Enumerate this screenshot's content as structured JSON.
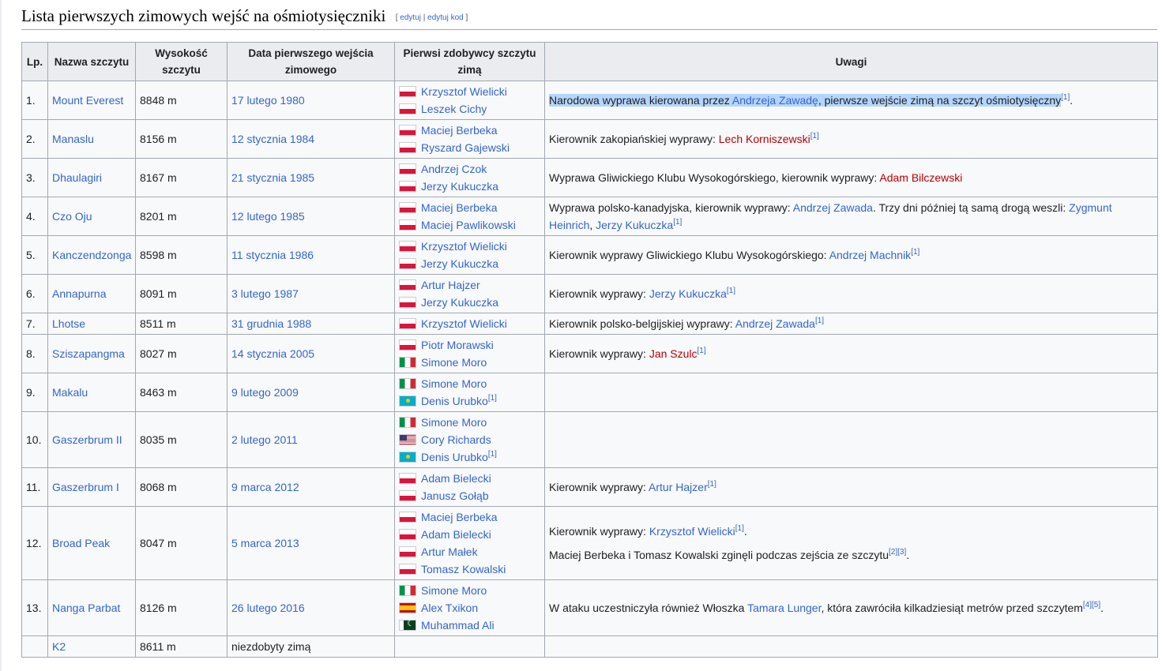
{
  "heading": {
    "title": "Lista pierwszych zimowych wejść na ośmiotysięczniki",
    "edit_open": "[ ",
    "edit_label": "edytuj",
    "edit_sep": " | ",
    "edit_code_label": "edytuj kod",
    "edit_close": " ]"
  },
  "table": {
    "headers": {
      "lp": "Lp.",
      "name": "Nazwa szczytu",
      "height": "Wysokość szczytu",
      "date": "Data pierwszego wejścia zimowego",
      "climbers": "Pierwsi zdobywcy szczytu zimą",
      "notes": "Uwagi"
    },
    "ref": {
      "r1": "[1]",
      "r2": "[2]",
      "r3": "[3]",
      "r4": "[4]",
      "r5": "[5]"
    },
    "rows": [
      {
        "lp": "1.",
        "name": "Mount Everest",
        "height": "8848 m",
        "date": "17 lutego 1980",
        "climbers": [
          "Krzysztof Wielicki",
          "Leszek Cichy"
        ],
        "note": {
          "t1": "Narodowa wyprawa kierowana przez ",
          "link": "Andrzeja Zawadę",
          "t2": ", pierwsze wejście zimą na szczyt ośmiotysięczny",
          "t3": "."
        }
      },
      {
        "lp": "2.",
        "name": "Manaslu",
        "height": "8156 m",
        "date": "12 stycznia 1984",
        "climbers": [
          "Maciej Berbeka",
          "Ryszard Gajewski"
        ],
        "note": {
          "t1": "Kierownik zakopiańskiej wyprawy: ",
          "link": "Lech Korniszewski"
        }
      },
      {
        "lp": "3.",
        "name": "Dhaulagiri",
        "height": "8167 m",
        "date": "21 stycznia 1985",
        "climbers": [
          "Andrzej Czok",
          "Jerzy Kukuczka"
        ],
        "note": {
          "t1": "Wyprawa Gliwickiego Klubu Wysokogórskiego, kierownik wyprawy: ",
          "link": "Adam Bilczewski"
        }
      },
      {
        "lp": "4.",
        "name": "Czo Oju",
        "height": "8201 m",
        "date": "12 lutego 1985",
        "climbers": [
          "Maciej Berbeka",
          "Maciej Pawlikowski"
        ],
        "note": {
          "t1": "Wyprawa polsko-kanadyjska, kierownik wyprawy: ",
          "link": "Andrzej Zawada",
          "t2": ". Trzy dni później tą samą drogą weszli: ",
          "link2": "Zygmunt Heinrich",
          "t3": ", ",
          "link3": "Jerzy Kukuczka"
        }
      },
      {
        "lp": "5.",
        "name": "Kanczendzonga",
        "height": "8598 m",
        "date": "11 stycznia 1986",
        "climbers": [
          "Krzysztof Wielicki",
          "Jerzy Kukuczka"
        ],
        "note": {
          "t1": "Kierownik wyprawy Gliwickiego Klubu Wysokogórskiego: ",
          "link": "Andrzej Machnik"
        }
      },
      {
        "lp": "6.",
        "name": "Annapurna",
        "height": "8091 m",
        "date": "3 lutego 1987",
        "climbers": [
          "Artur Hajzer",
          "Jerzy Kukuczka"
        ],
        "note": {
          "t1": "Kierownik wyprawy: ",
          "link": "Jerzy Kukuczka"
        }
      },
      {
        "lp": "7.",
        "name": "Lhotse",
        "height": "8511 m",
        "date": "31 grudnia 1988",
        "climbers": [
          "Krzysztof Wielicki"
        ],
        "note": {
          "t1": "Kierownik polsko-belgijskiej wyprawy: ",
          "link": "Andrzej Zawada"
        }
      },
      {
        "lp": "8.",
        "name": "Sziszapangma",
        "height": "8027 m",
        "date": "14 stycznia 2005",
        "climbers": [
          "Piotr Morawski",
          "Simone Moro"
        ],
        "note": {
          "t1": "Kierownik wyprawy: ",
          "link": "Jan Szulc"
        }
      },
      {
        "lp": "9.",
        "name": "Makalu",
        "height": "8463 m",
        "date": "9 lutego 2009",
        "climbers": [
          "Simone Moro",
          "Denis Urubko"
        ]
      },
      {
        "lp": "10.",
        "name": "Gaszerbrum II",
        "height": "8035 m",
        "date": "2 lutego 2011",
        "climbers": [
          "Simone Moro",
          "Cory Richards",
          "Denis Urubko"
        ]
      },
      {
        "lp": "11.",
        "name": "Gaszerbrum I",
        "height": "8068 m",
        "date": "9 marca 2012",
        "climbers": [
          "Adam Bielecki",
          "Janusz Gołąb"
        ],
        "note": {
          "t1": "Kierownik wyprawy: ",
          "link": "Artur Hajzer"
        }
      },
      {
        "lp": "12.",
        "name": "Broad Peak",
        "height": "8047 m",
        "date": "5 marca 2013",
        "climbers": [
          "Maciej Berbeka",
          "Adam Bielecki",
          "Artur Małek",
          "Tomasz Kowalski"
        ],
        "note": {
          "t1": "Kierownik wyprawy: ",
          "link": "Krzysztof Wielicki",
          "t2": ".",
          "p2": "Maciej Berbeka i Tomasz Kowalski zginęli podczas zejścia ze szczytu",
          "p2end": "."
        }
      },
      {
        "lp": "13.",
        "name": "Nanga Parbat",
        "height": "8126 m",
        "date": "26 lutego 2016",
        "climbers": [
          "Simone Moro",
          "Alex Txikon",
          "Muhammad Ali"
        ],
        "note": {
          "t1": "W ataku uczestniczyła również Włoszka ",
          "link": "Tamara Lunger",
          "t2": ", która zawróciła kilkadziesiąt metrów przed szczytem",
          "t3": "."
        }
      },
      {
        "lp": "",
        "name": "K2",
        "height": "8611 m",
        "date": "niezdobyty zimą"
      }
    ]
  }
}
